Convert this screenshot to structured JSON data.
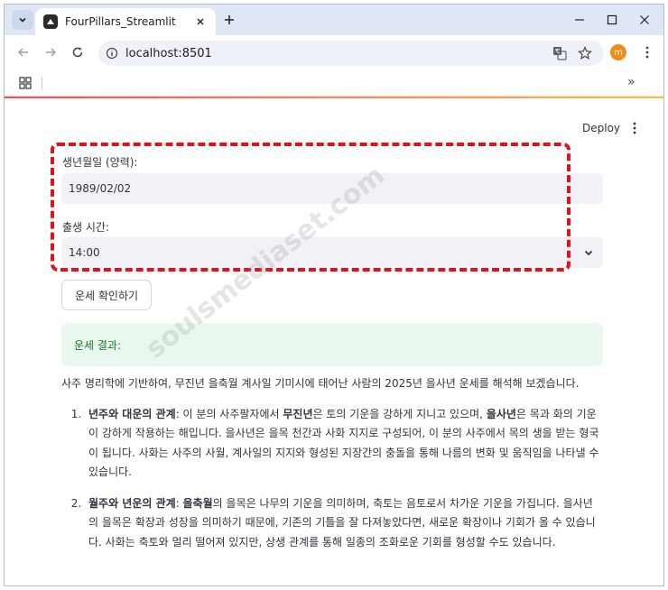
{
  "browser": {
    "tab_title": "FourPillars_Streamlit",
    "url": "localhost:8501",
    "profile_initial": "m",
    "bookmarks_more": "»"
  },
  "app": {
    "deploy_label": "Deploy",
    "birth_label": "생년월일 (양력):",
    "birth_value": "1989/02/02",
    "time_label": "출생 시간:",
    "time_value": "14:00",
    "button_label": "운세 확인하기",
    "result_title": "운세 결과:",
    "intro": "사주 명리학에 기반하여, 무진년 을축월 계사일 기미시에 태어난 사람의 2025년 을사년 운세를 해석해 보겠습니다.",
    "items": [
      {
        "t1": "년주와 대운의 관계",
        "t2": ": 이 분의 사주팔자에서 ",
        "t3": "무진년",
        "t4": "은 토의 기운을 강하게 지니고 있으며, ",
        "t5": "을사년",
        "t6": "은 목과 화의 기운이 강하게 작용하는 해입니다. 을사년은 을목 천간과 사화 지지로 구성되어, 이 분의 사주에서 목의 생을 받는 형국이 됩니다. 사화는 사주의 사월, 계사일의 지지와 형성된 지장간의 충돌을 통해 나름의 변화 및 움직임을 나타낼 수 있습니다."
      },
      {
        "t1": "월주와 년운의 관계",
        "t2": ": ",
        "t3": "을축월",
        "t4": "의 을목은 나무의 기운을 의미하며, 축토는 음토로서 차가운 기운을 가집니다. 을사년의 을목은 확장과 성장을 의미하기 때문에, 기존의 기틀을 잘 다져놓았다면, 새로운 확장이나 기회가 올 수 있습니다. 사화는 축토와 멀리 떨어져 있지만, 상생 관계를 통해 일종의 조화로운 기회를 형성할 수도 있습니다.",
        "t5": "",
        "t6": ""
      }
    ],
    "watermark": "soulsmediaset.com"
  }
}
